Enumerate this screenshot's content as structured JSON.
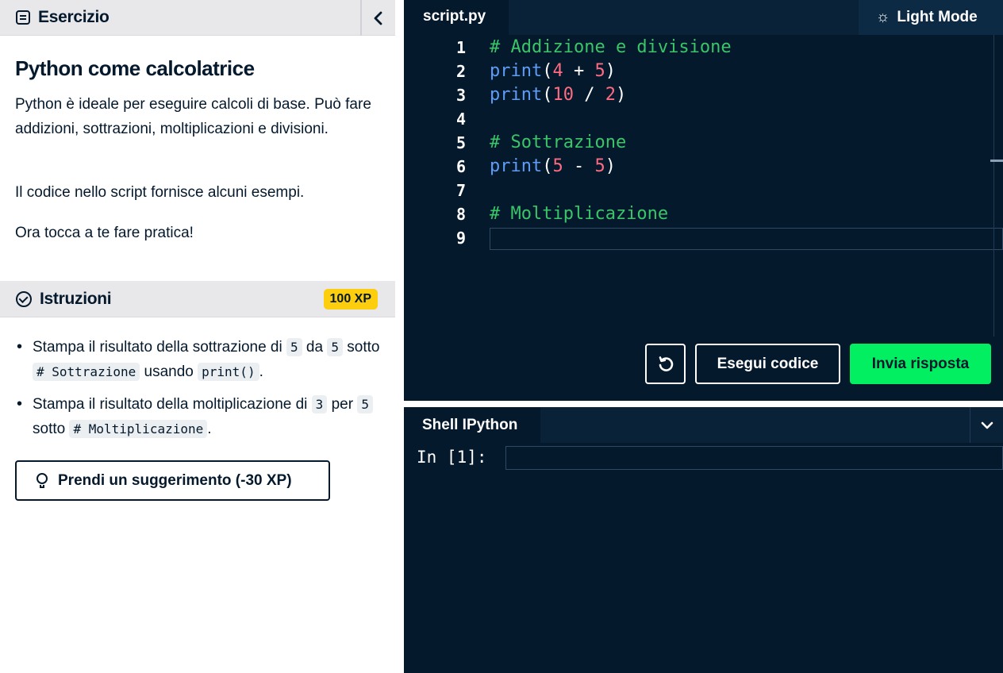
{
  "exercise": {
    "header": "Esercizio",
    "title": "Python come calcolatrice",
    "p1": "Python è ideale per eseguire calcoli di base. Può fare addizioni, sottrazioni, moltiplicazioni e divisioni.",
    "p2": "Il codice nello script fornisce alcuni esempi.",
    "p3": "Ora tocca a te fare pratica!"
  },
  "instructions": {
    "header": "Istruzioni",
    "xp": "100 XP",
    "items": [
      {
        "t1": "Stampa il risultato della sottrazione di ",
        "c1": "5",
        "t2": " da ",
        "c2": "5",
        "t3": " sotto ",
        "c3": "# Sottrazione",
        "t4": " usando ",
        "c4": "print()",
        "t5": "."
      },
      {
        "t1": "Stampa il risultato della moltiplicazione di ",
        "c1": "3",
        "t2": " per ",
        "c2": "5",
        "t3": " sotto ",
        "c3": "# Moltiplicazione",
        "t4": "."
      }
    ],
    "hint_label": "Prendi un suggerimento (-30 XP)"
  },
  "editor": {
    "tab": "script.py",
    "light_mode": "Light Mode",
    "lines": [
      {
        "n": "1",
        "comment": "# Addizione e divisione"
      },
      {
        "n": "2",
        "fn": "print",
        "a": "4",
        "op": " + ",
        "b": "5"
      },
      {
        "n": "3",
        "fn": "print",
        "a": "10",
        "op": " / ",
        "b": "2"
      },
      {
        "n": "4"
      },
      {
        "n": "5",
        "comment": "# Sottrazione"
      },
      {
        "n": "6",
        "fn": "print",
        "a": "5",
        "op": " - ",
        "b": "5"
      },
      {
        "n": "7"
      },
      {
        "n": "8",
        "comment": "# Moltiplicazione"
      },
      {
        "n": "9"
      }
    ],
    "run_label": "Esegui codice",
    "submit_label": "Invia risposta"
  },
  "shell": {
    "tab": "Shell IPython",
    "prompt": "In [1]:"
  },
  "colors": {
    "editor_bg": "#05192d",
    "accent_green": "#03ef62",
    "xp_yellow": "#fcce0d"
  }
}
